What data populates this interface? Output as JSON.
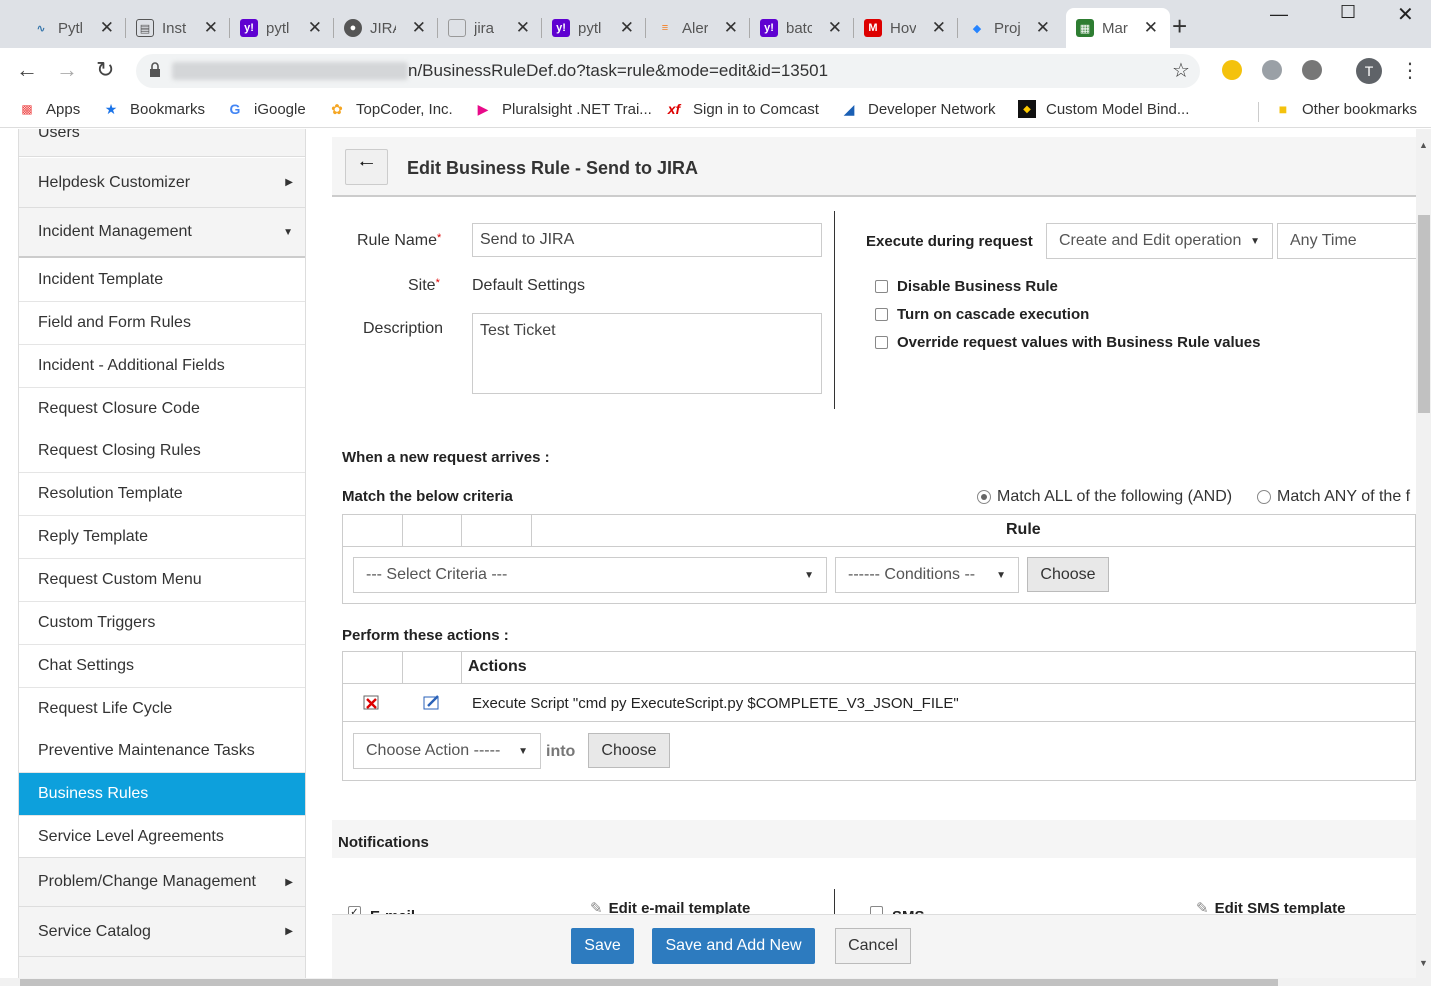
{
  "browser": {
    "tabs": [
      {
        "label": "Pytl",
        "icon": "python-icon"
      },
      {
        "label": "Inst",
        "icon": "doc-icon"
      },
      {
        "label": "pytl",
        "icon": "yahoo-icon"
      },
      {
        "label": "JIRA",
        "icon": "globe-icon"
      },
      {
        "label": "jira",
        "icon": "page-icon"
      },
      {
        "label": "pytl",
        "icon": "yahoo-icon"
      },
      {
        "label": "Aler",
        "icon": "stack-icon"
      },
      {
        "label": "batc",
        "icon": "yahoo-icon"
      },
      {
        "label": "Hov",
        "icon": "m-icon"
      },
      {
        "label": "Proj",
        "icon": "jira-icon"
      },
      {
        "label": "Mar",
        "icon": "sdp-icon"
      }
    ],
    "url": "n/BusinessRuleDef.do?task=rule&mode=edit&id=13501",
    "avatar_letter": "T",
    "bookmarks": [
      {
        "label": "Apps"
      },
      {
        "label": "Bookmarks"
      },
      {
        "label": "iGoogle"
      },
      {
        "label": "TopCoder, Inc."
      },
      {
        "label": "Pluralsight .NET Trai..."
      },
      {
        "label": "Sign in to Comcast"
      },
      {
        "label": "Developer Network"
      },
      {
        "label": "Custom Model Bind..."
      },
      {
        "label": "Other bookmarks"
      }
    ]
  },
  "sidebar": {
    "partial_top": "Users",
    "groups": [
      {
        "label": "Helpdesk Customizer"
      },
      {
        "label": "Incident Management"
      }
    ],
    "items": [
      {
        "label": "Incident Template"
      },
      {
        "label": "Field and Form Rules"
      },
      {
        "label": "Incident - Additional Fields"
      },
      {
        "label": "Request Closure Code"
      },
      {
        "label": "Request Closing Rules"
      },
      {
        "label": "Resolution Template"
      },
      {
        "label": "Reply Template"
      },
      {
        "label": "Request Custom Menu"
      },
      {
        "label": "Custom Triggers"
      },
      {
        "label": "Chat Settings"
      },
      {
        "label": "Request Life Cycle"
      },
      {
        "label": "Preventive Maintenance Tasks"
      },
      {
        "label": "Business Rules"
      },
      {
        "label": "Service Level Agreements"
      }
    ],
    "bottom_groups": [
      {
        "label": "Problem/Change Management"
      },
      {
        "label": "Service Catalog"
      }
    ]
  },
  "form": {
    "title": "Edit Business Rule - Send to JIRA",
    "rule_name_label": "Rule Name",
    "rule_name_value": "Send to JIRA",
    "site_label": "Site",
    "site_value": "Default Settings",
    "description_label": "Description",
    "description_value": "Test Ticket",
    "execute_label": "Execute during request",
    "execute_option": "Create and Edit operation",
    "time_option": "Any Time",
    "checkboxes": [
      {
        "label": "Disable Business Rule",
        "checked": false
      },
      {
        "label": "Turn on cascade execution",
        "checked": false
      },
      {
        "label": "Override request values with Business Rule values",
        "checked": false
      }
    ],
    "when_label": "When a new request arrives :",
    "match_label": "Match the below criteria",
    "match_all": "Match ALL of the following (AND)",
    "match_any": "Match ANY of the f",
    "rule_header": "Rule",
    "select_criteria": "--- Select Criteria ---",
    "conditions": "------ Conditions --",
    "choose": "Choose",
    "perform_label": "Perform these actions :",
    "actions_header": "Actions",
    "action_row": "Execute Script \"cmd  py ExecuteScript.py $COMPLETE_V3_JSON_FILE\"",
    "choose_action": "Choose Action -----",
    "into": "into",
    "notifications_label": "Notifications",
    "email_label": "E-mail",
    "edit_email": "Edit e-mail template",
    "sms_label": "SMS",
    "edit_sms": "Edit SMS template",
    "save": "Save",
    "save_add": "Save and Add New",
    "cancel": "Cancel"
  },
  "colors": {
    "accent": "#0da0dc",
    "primary_button": "#2d7bbf"
  }
}
